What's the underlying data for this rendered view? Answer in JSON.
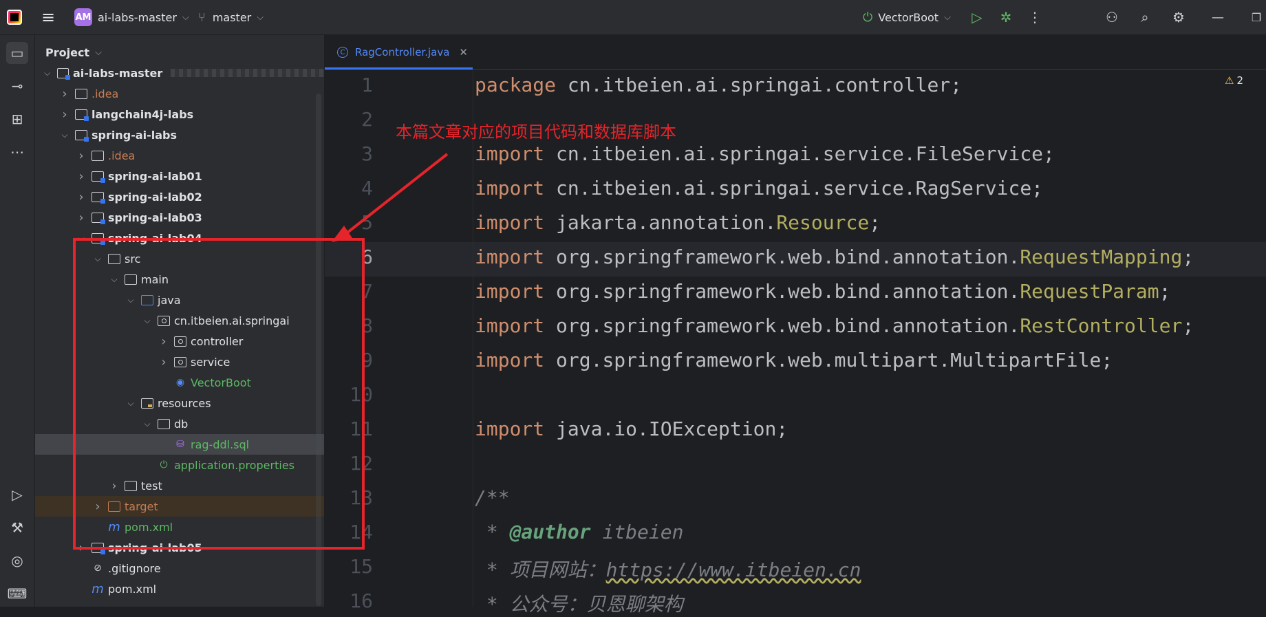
{
  "topbar": {
    "project_badge": "AM",
    "project_name": "ai-labs-master",
    "branch": "master",
    "run_config": "VectorBoot"
  },
  "panel": {
    "title": "Project",
    "tree": [
      {
        "label": "ai-labs-master",
        "depth": 0,
        "arrow": "open",
        "icon": "module-folder",
        "bold": true,
        "blurred_path": true
      },
      {
        "label": ".idea",
        "depth": 1,
        "arrow": "closed",
        "icon": "folder",
        "color": "orange"
      },
      {
        "label": "langchain4j-labs",
        "depth": 1,
        "arrow": "closed",
        "icon": "module-folder",
        "bold": true
      },
      {
        "label": "spring-ai-labs",
        "depth": 1,
        "arrow": "open",
        "icon": "module-folder",
        "bold": true
      },
      {
        "label": ".idea",
        "depth": 2,
        "arrow": "closed",
        "icon": "folder",
        "color": "orange"
      },
      {
        "label": "spring-ai-lab01",
        "depth": 2,
        "arrow": "closed",
        "icon": "module-folder",
        "bold": true
      },
      {
        "label": "spring-ai-lab02",
        "depth": 2,
        "arrow": "closed",
        "icon": "module-folder",
        "bold": true
      },
      {
        "label": "spring-ai-lab03",
        "depth": 2,
        "arrow": "closed",
        "icon": "module-folder",
        "bold": true
      },
      {
        "label": "spring-ai-lab04",
        "depth": 2,
        "arrow": "open",
        "icon": "module-folder",
        "bold": true
      },
      {
        "label": "src",
        "depth": 3,
        "arrow": "open",
        "icon": "folder"
      },
      {
        "label": "main",
        "depth": 4,
        "arrow": "open",
        "icon": "folder"
      },
      {
        "label": "java",
        "depth": 5,
        "arrow": "open",
        "icon": "source-folder"
      },
      {
        "label": "cn.itbeien.ai.springai",
        "depth": 6,
        "arrow": "open",
        "icon": "package"
      },
      {
        "label": "controller",
        "depth": 7,
        "arrow": "closed",
        "icon": "package"
      },
      {
        "label": "service",
        "depth": 7,
        "arrow": "closed",
        "icon": "package"
      },
      {
        "label": "VectorBoot",
        "depth": 7,
        "arrow": "none",
        "icon": "spring-class",
        "color": "green"
      },
      {
        "label": "resources",
        "depth": 5,
        "arrow": "open",
        "icon": "resources-folder"
      },
      {
        "label": "db",
        "depth": 6,
        "arrow": "open",
        "icon": "folder"
      },
      {
        "label": "rag-ddl.sql",
        "depth": 7,
        "arrow": "none",
        "icon": "sql-file",
        "color": "green",
        "selected": true
      },
      {
        "label": "application.properties",
        "depth": 6,
        "arrow": "none",
        "icon": "spring-properties",
        "color": "green"
      },
      {
        "label": "test",
        "depth": 4,
        "arrow": "closed",
        "icon": "folder"
      },
      {
        "label": "target",
        "depth": 3,
        "arrow": "closed",
        "icon": "excluded-folder",
        "color": "orange",
        "excluded": true
      },
      {
        "label": "pom.xml",
        "depth": 3,
        "arrow": "none",
        "icon": "maven-file",
        "color": "green"
      },
      {
        "label": "spring-ai-lab05",
        "depth": 2,
        "arrow": "closed",
        "icon": "module-folder",
        "bold": true
      },
      {
        "label": ".gitignore",
        "depth": 2,
        "arrow": "none",
        "icon": "ignore-file"
      },
      {
        "label": "pom.xml",
        "depth": 2,
        "arrow": "none",
        "icon": "maven-file"
      }
    ]
  },
  "editor": {
    "tab_label": "RagController.java",
    "warnings_count": "2",
    "line_numbers": [
      "1",
      "2",
      "3",
      "4",
      "5",
      "6",
      "7",
      "8",
      "9",
      "10",
      "11",
      "12",
      "13",
      "14",
      "15",
      "16"
    ],
    "lines": [
      [
        {
          "t": "package ",
          "c": "kw"
        },
        {
          "t": "cn.itbeien.ai.springai.controller;",
          "c": ""
        }
      ],
      [],
      [
        {
          "t": "import ",
          "c": "kw"
        },
        {
          "t": "cn.itbeien.ai.springai.service.FileService;",
          "c": ""
        }
      ],
      [
        {
          "t": "import ",
          "c": "kw"
        },
        {
          "t": "cn.itbeien.ai.springai.service.RagService;",
          "c": ""
        }
      ],
      [
        {
          "t": "import ",
          "c": "kw"
        },
        {
          "t": "jakarta.annotation.",
          "c": ""
        },
        {
          "t": "Resource",
          "c": "ann"
        },
        {
          "t": ";",
          "c": ""
        }
      ],
      [
        {
          "t": "import ",
          "c": "kw"
        },
        {
          "t": "org.springframework.web.bind.annotation.",
          "c": ""
        },
        {
          "t": "RequestMapping",
          "c": "ann"
        },
        {
          "t": ";",
          "c": ""
        }
      ],
      [
        {
          "t": "import ",
          "c": "kw"
        },
        {
          "t": "org.springframework.web.bind.annotation.",
          "c": ""
        },
        {
          "t": "RequestParam",
          "c": "ann"
        },
        {
          "t": ";",
          "c": ""
        }
      ],
      [
        {
          "t": "import ",
          "c": "kw"
        },
        {
          "t": "org.springframework.web.bind.annotation.",
          "c": ""
        },
        {
          "t": "RestController",
          "c": "ann"
        },
        {
          "t": ";",
          "c": ""
        }
      ],
      [
        {
          "t": "import ",
          "c": "kw"
        },
        {
          "t": "org.springframework.web.multipart.MultipartFile;",
          "c": ""
        }
      ],
      [],
      [
        {
          "t": "import ",
          "c": "kw"
        },
        {
          "t": "java.io.IOException;",
          "c": ""
        }
      ],
      [],
      [
        {
          "t": "/**",
          "c": "cmt"
        }
      ],
      [
        {
          "t": " * ",
          "c": "cmt"
        },
        {
          "t": "@author",
          "c": "doctag"
        },
        {
          "t": " itbeien",
          "c": "cmt"
        }
      ],
      [
        {
          "t": " * 项目网站：",
          "c": "cmt"
        },
        {
          "t": "https://www.itbeien.cn",
          "c": "link"
        }
      ],
      [
        {
          "t": " * 公众号：贝恩聊架构",
          "c": "cmt"
        }
      ]
    ]
  },
  "annotation": {
    "text": "本篇文章对应的项目代码和数据库脚本",
    "color": "#e5242b"
  }
}
